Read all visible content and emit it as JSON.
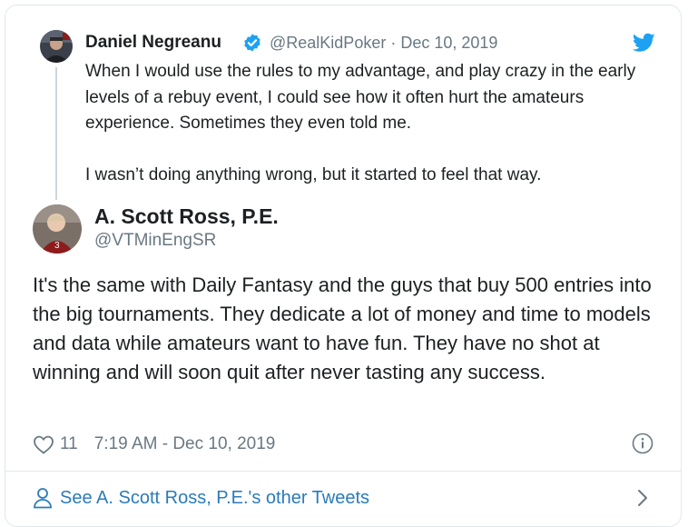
{
  "colors": {
    "text": "#1c2022",
    "secondary": "#697882",
    "link": "#2b7bb9",
    "twitter_blue": "#1da1f2",
    "border": "#e1e8ed"
  },
  "quoted_tweet": {
    "author_name": "Daniel Negreanu",
    "verified": true,
    "handle_date": "@RealKidPoker · Dec 10, 2019",
    "paragraphs": [
      "When I would use the rules to my advantage, and play crazy in the early levels of a rebuy event, I could see how it often hurt the amateurs experience. Sometimes they even told me.",
      "I wasn’t doing anything wrong, but it started to feel that way."
    ]
  },
  "main_tweet": {
    "author_name": "A. Scott Ross, P.E.",
    "handle": "@VTMinEngSR",
    "text": "It's the same with Daily Fantasy and the guys that buy 500 entries into the big tournaments.  They dedicate a lot of money and time to models and data while amateurs want to have fun. They have no shot at winning and will soon quit after never tasting any success.",
    "like_count": "11",
    "timestamp": "7:19 AM - Dec 10, 2019"
  },
  "footer": {
    "see_more_label": "See A. Scott Ross, P.E.'s other Tweets"
  },
  "icons": {
    "verified": "verified-badge-icon",
    "twitter": "twitter-bird-icon",
    "like": "heart-icon",
    "info": "info-icon",
    "profile": "person-icon",
    "more": "chevron-right-icon"
  }
}
